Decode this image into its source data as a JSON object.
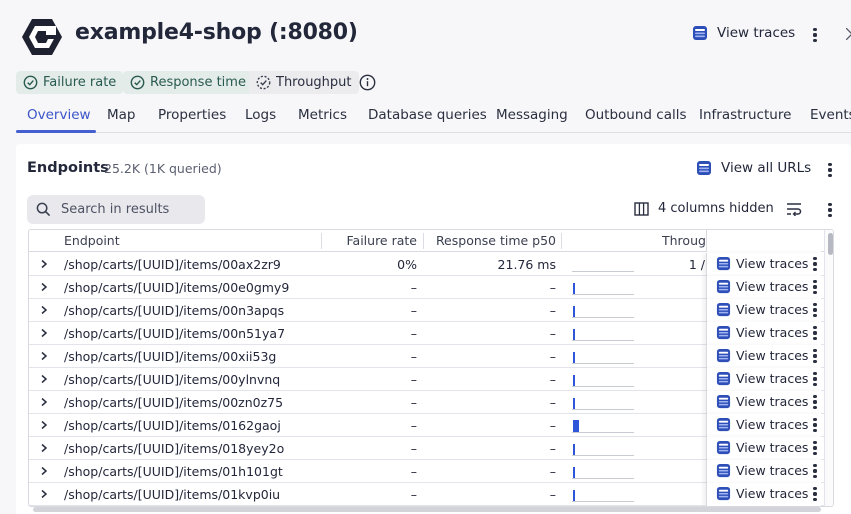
{
  "app": {
    "title": "example4-shop (:8080)",
    "view_traces_label": "View traces",
    "logo_icon": "hexagon-g-logo",
    "trace_icon": "database-trace-icon"
  },
  "health_chips": [
    {
      "label": "Failure rate",
      "icon": "check-circle-icon",
      "style": "ok"
    },
    {
      "label": "Response time",
      "icon": "check-circle-icon",
      "style": "ok"
    },
    {
      "label": "Throughput",
      "icon": "dashed-circle-icon",
      "style": "neutral"
    }
  ],
  "tabs": [
    {
      "label": "Overview",
      "active": true
    },
    {
      "label": "Map"
    },
    {
      "label": "Properties"
    },
    {
      "label": "Logs"
    },
    {
      "label": "Metrics"
    },
    {
      "label": "Database queries"
    },
    {
      "label": "Messaging"
    },
    {
      "label": "Outbound calls"
    },
    {
      "label": "Infrastructure"
    },
    {
      "label": "Events"
    }
  ],
  "endpoints": {
    "title": "Endpoints",
    "count": "25.2K (1K queried)",
    "view_all_urls_label": "View all URLs",
    "search": {
      "placeholder": "Search in results",
      "value": ""
    },
    "columns_hidden_label": "4 columns hidden",
    "columns": {
      "endpoint": "Endpoint",
      "failure_rate": "Failure rate",
      "response_time": "Response time p50",
      "throughput": "Throughput"
    },
    "row_action_label": "View traces",
    "rows": [
      {
        "endpoint": "/shop/carts/[UUID]/items/00ax2zr9",
        "failure_rate": "0%",
        "response_time": "21.76 ms",
        "throughput": "1 /",
        "spark": 0
      },
      {
        "endpoint": "/shop/carts/[UUID]/items/00e0gmy9",
        "failure_rate": "–",
        "response_time": "–",
        "throughput": "",
        "spark": 0.75
      },
      {
        "endpoint": "/shop/carts/[UUID]/items/00n3apqs",
        "failure_rate": "–",
        "response_time": "–",
        "throughput": "",
        "spark": 0.75
      },
      {
        "endpoint": "/shop/carts/[UUID]/items/00n51ya7",
        "failure_rate": "–",
        "response_time": "–",
        "throughput": "",
        "spark": 0.75
      },
      {
        "endpoint": "/shop/carts/[UUID]/items/00xii53g",
        "failure_rate": "–",
        "response_time": "–",
        "throughput": "",
        "spark": 0.75
      },
      {
        "endpoint": "/shop/carts/[UUID]/items/00ylnvnq",
        "failure_rate": "–",
        "response_time": "–",
        "throughput": "",
        "spark": 0.75
      },
      {
        "endpoint": "/shop/carts/[UUID]/items/00zn0z75",
        "failure_rate": "–",
        "response_time": "–",
        "throughput": "",
        "spark": 0.75
      },
      {
        "endpoint": "/shop/carts/[UUID]/items/0162gaoj",
        "failure_rate": "–",
        "response_time": "–",
        "throughput": "",
        "spark": 0.85
      },
      {
        "endpoint": "/shop/carts/[UUID]/items/018yey2o",
        "failure_rate": "–",
        "response_time": "–",
        "throughput": "",
        "spark": 0.75
      },
      {
        "endpoint": "/shop/carts/[UUID]/items/01h101gt",
        "failure_rate": "–",
        "response_time": "–",
        "throughput": "",
        "spark": 0.75
      },
      {
        "endpoint": "/shop/carts/[UUID]/items/01kvp0iu",
        "failure_rate": "–",
        "response_time": "–",
        "throughput": "",
        "spark": 0.75
      }
    ]
  },
  "colors": {
    "accent": "#4460d0",
    "spark_bar": "#2f56d9",
    "chip_ok_bg": "#e4ece9",
    "chip_ok_text": "#285a4f"
  }
}
